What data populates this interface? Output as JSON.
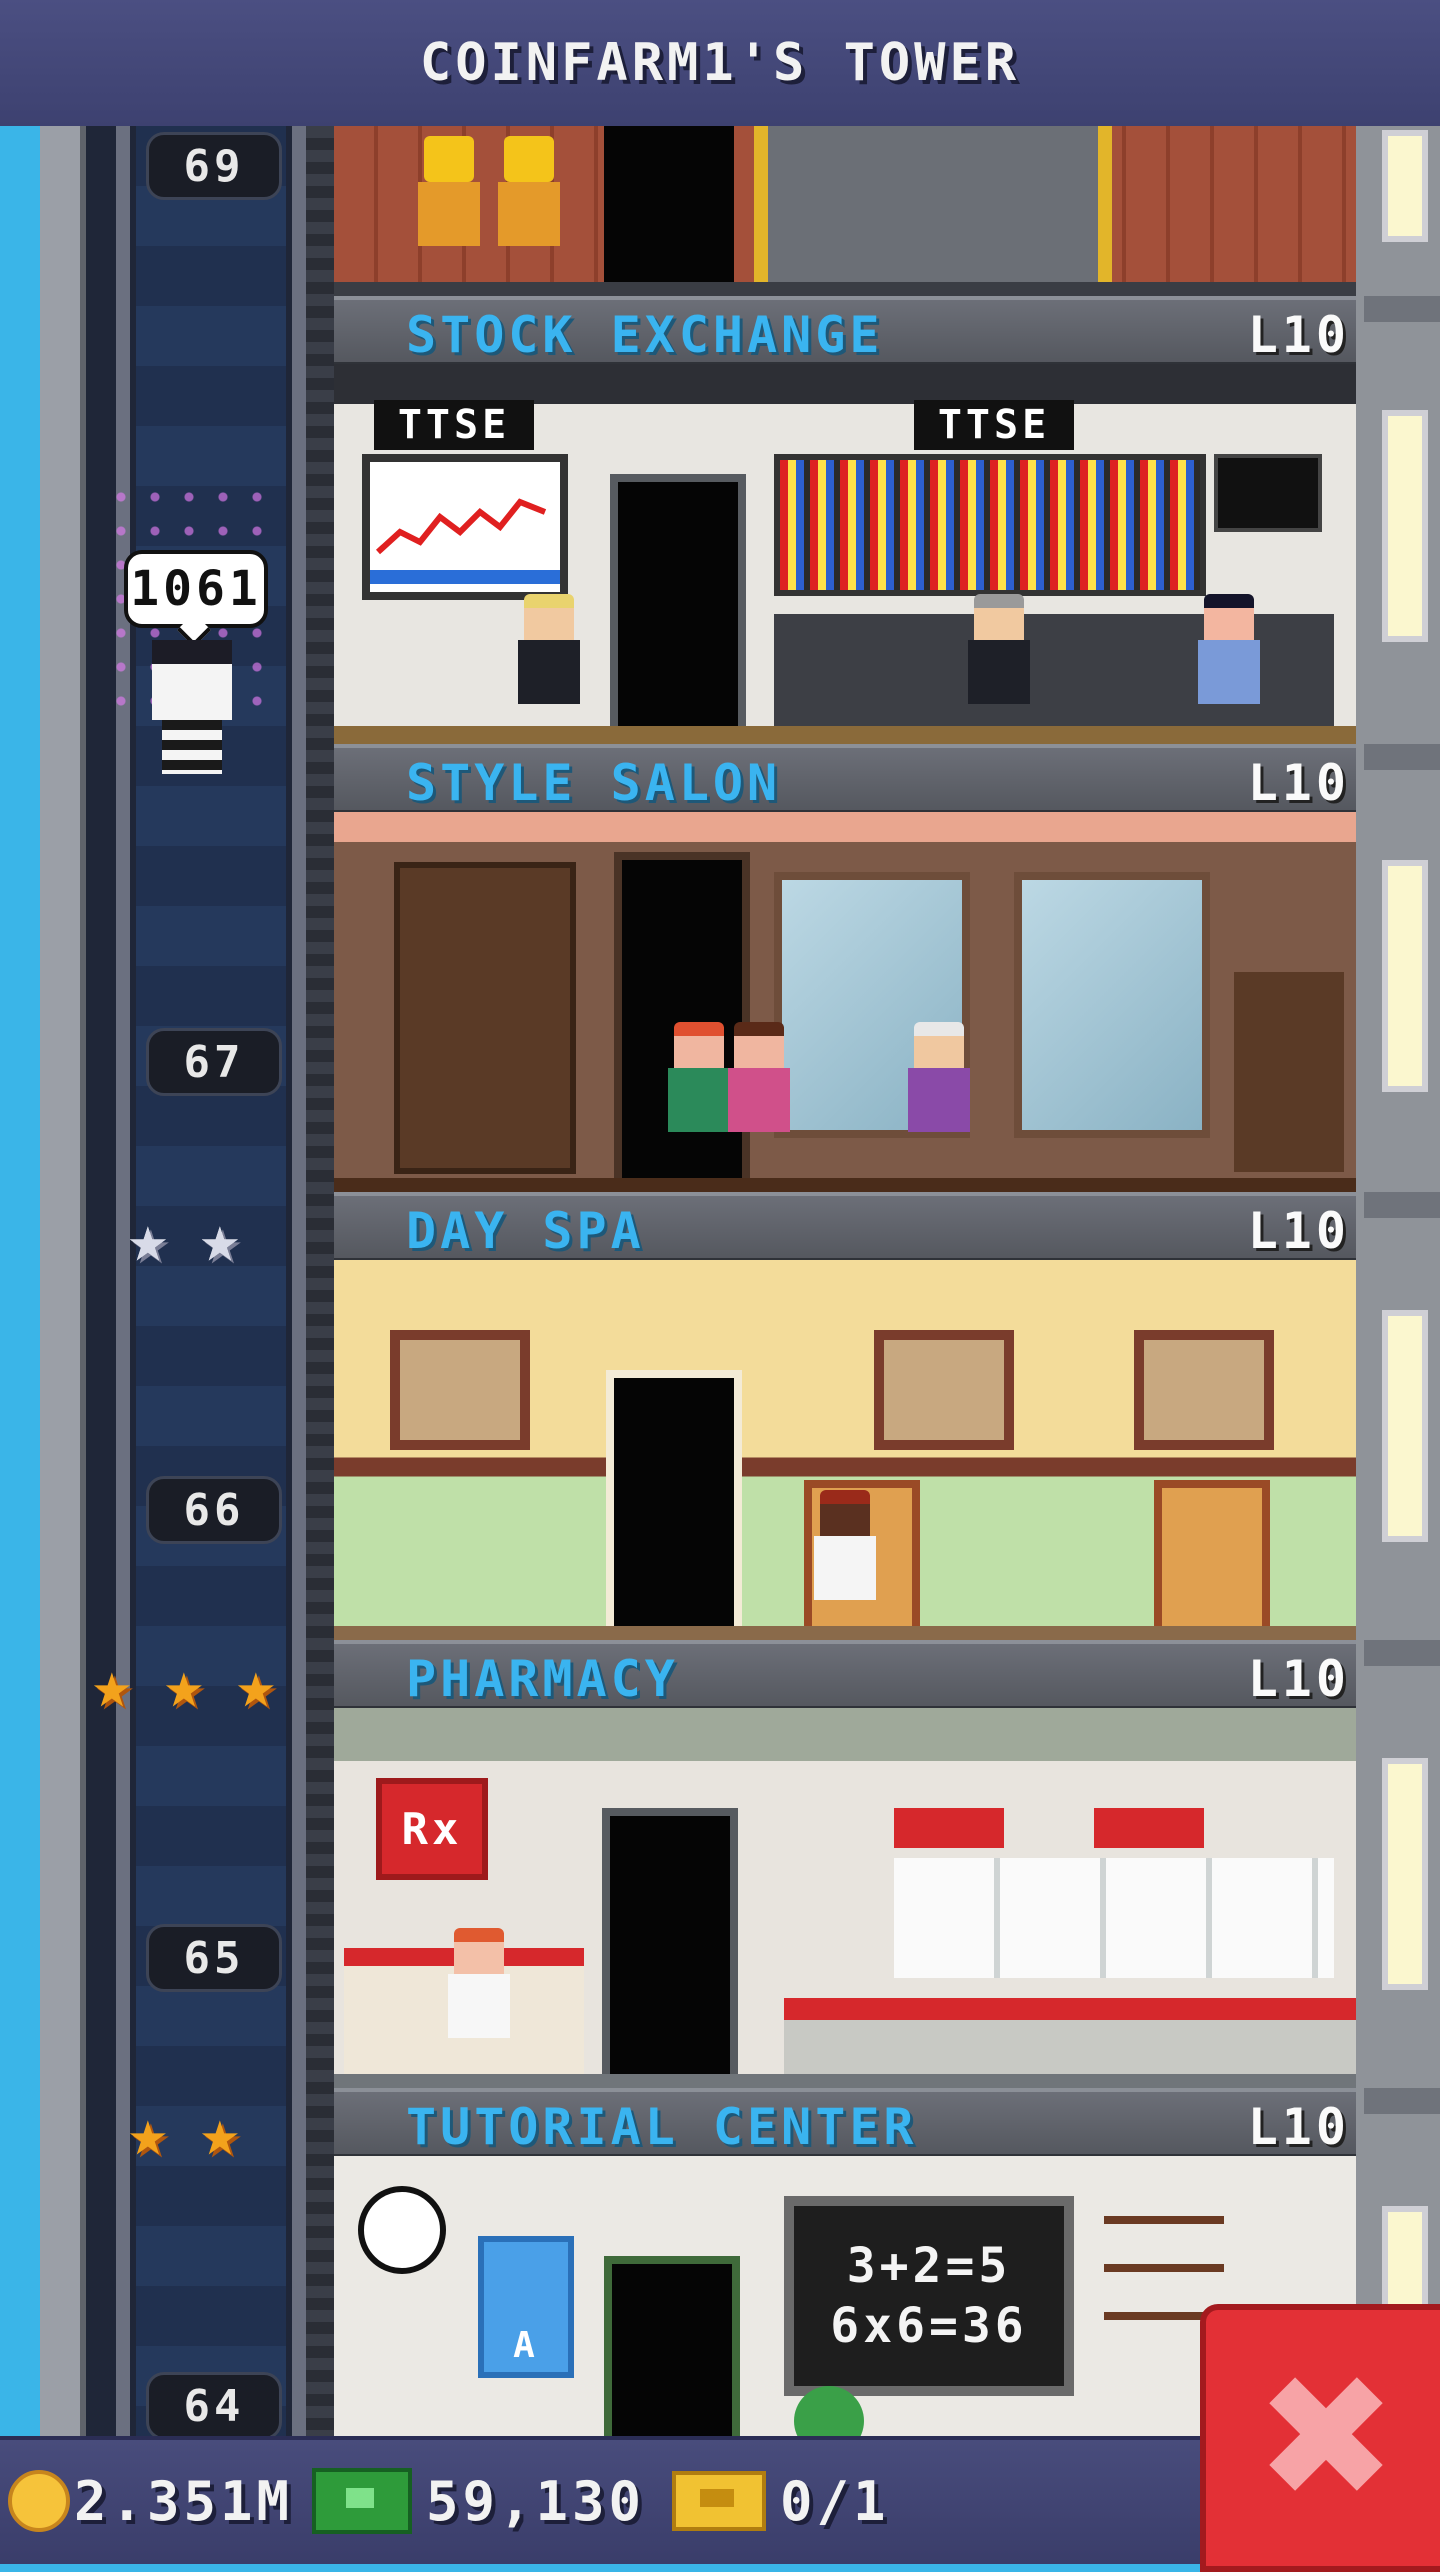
{
  "header": {
    "title": "COINFARM1'S TOWER"
  },
  "elevator": {
    "floor_numbers": [
      "69",
      "67",
      "66",
      "65",
      "64"
    ],
    "passenger_badge": "1061",
    "star_rows": [
      {
        "kind": "silver",
        "count": 2
      },
      {
        "kind": "gold",
        "count": 3
      },
      {
        "kind": "gold",
        "count": 2
      }
    ]
  },
  "floors": [
    {
      "name": "STOCK EXCHANGE",
      "level": "L10",
      "signs": [
        "TTSE",
        "TTSE"
      ]
    },
    {
      "name": "STYLE SALON",
      "level": "L10"
    },
    {
      "name": "DAY SPA",
      "level": "L10"
    },
    {
      "name": "PHARMACY",
      "level": "L10",
      "sign": "Rx"
    },
    {
      "name": "TUTORIAL CENTER",
      "level": "L10",
      "board_lines": [
        "3+2=5",
        "6x6=36"
      ],
      "poster": "A"
    }
  ],
  "status_bar": {
    "coins": "2.351M",
    "bux": "59,130",
    "tickets": "0/1"
  },
  "colors": {
    "header_bg": "#4b4f82",
    "floor_name": "#3ab4f0",
    "sky": "#3ab5e8",
    "close_button": "#e33036"
  },
  "icons": {
    "coin": "coin-icon",
    "bux": "bux-icon",
    "ticket": "ticket-icon",
    "close": "close-icon"
  }
}
